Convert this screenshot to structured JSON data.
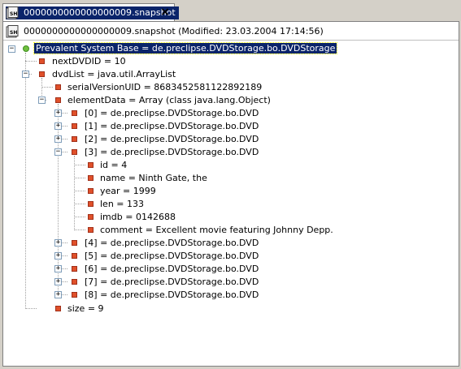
{
  "tab": {
    "title": "0000000000000000009.snapshot",
    "close_glyph": "×",
    "icon": "snapshot-icon"
  },
  "file": {
    "label": "0000000000000000009.snapshot (Modified: 23.03.2004 17:14:56)",
    "icon": "snapshot-file-icon"
  },
  "tree": {
    "root": "Prevalent System Base = de.preclipse.DVDStorage.bo.DVDStorage",
    "next_dvd_id": "nextDVDID = 10",
    "dvd_list": "dvdList = java.util.ArrayList",
    "serial_version_uid": "serialVersionUID = 8683452581122892189",
    "element_data": "elementData = Array (class java.lang.Object)",
    "dvd0": "[0] = de.preclipse.DVDStorage.bo.DVD",
    "dvd1": "[1] = de.preclipse.DVDStorage.bo.DVD",
    "dvd2": "[2] = de.preclipse.DVDStorage.bo.DVD",
    "dvd3": "[3] = de.preclipse.DVDStorage.bo.DVD",
    "dvd3_id": "id = 4",
    "dvd3_name": "name = Ninth Gate, the",
    "dvd3_year": "year = 1999",
    "dvd3_len": "len = 133",
    "dvd3_imdb": "imdb = 0142688",
    "dvd3_comment": "comment = Excellent movie featuring Johnny Depp.",
    "dvd4": "[4] = de.preclipse.DVDStorage.bo.DVD",
    "dvd5": "[5] = de.preclipse.DVDStorage.bo.DVD",
    "dvd6": "[6] = de.preclipse.DVDStorage.bo.DVD",
    "dvd7": "[7] = de.preclipse.DVDStorage.bo.DVD",
    "dvd8": "[8] = de.preclipse.DVDStorage.bo.DVD",
    "size": "size = 9",
    "expand_glyph": "+",
    "collapse_glyph": "−"
  },
  "colors": {
    "selection": "#0a246a",
    "bullet": "#e0502a",
    "root_dot": "#6fbf3f",
    "chrome": "#d4d0c8"
  }
}
